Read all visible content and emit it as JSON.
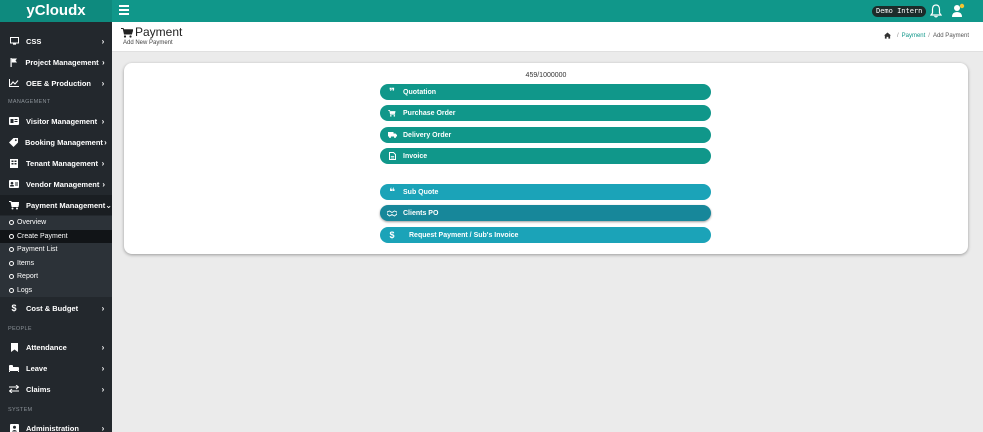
{
  "app": {
    "brand": "yCloudx",
    "demo_badge": "Demo Intern"
  },
  "sidebar": {
    "items_top": [
      {
        "label": "CSS",
        "icon": "monitor-icon"
      },
      {
        "label": "Project Management",
        "icon": "flag-icon"
      },
      {
        "label": "OEE & Production",
        "icon": "line-chart-icon"
      }
    ],
    "section_management": "MANAGEMENT",
    "items_management": [
      {
        "label": "Visitor Management",
        "icon": "id-card-icon"
      },
      {
        "label": "Booking Management",
        "icon": "tag-icon"
      },
      {
        "label": "Tenant Management",
        "icon": "building-icon"
      },
      {
        "label": "Vendor Management",
        "icon": "address-card-icon"
      },
      {
        "label": "Payment Management",
        "icon": "cart-icon"
      }
    ],
    "payment_sub": [
      {
        "label": "Overview"
      },
      {
        "label": "Create Payment"
      },
      {
        "label": "Payment List"
      },
      {
        "label": "Items"
      },
      {
        "label": "Report"
      },
      {
        "label": "Logs"
      }
    ],
    "cost_budget": {
      "label": "Cost & Budget",
      "icon": "dollar-icon"
    },
    "section_people": "PEOPLE",
    "items_people": [
      {
        "label": "Attendance",
        "icon": "bookmark-icon"
      },
      {
        "label": "Leave",
        "icon": "bed-icon"
      },
      {
        "label": "Claims",
        "icon": "exchange-icon"
      }
    ],
    "section_system": "SYSTEM",
    "administration": {
      "label": "Administration",
      "icon": "user-box-icon"
    }
  },
  "header": {
    "title": "Payment",
    "subtitle": "Add New Payment",
    "breadcrumb": {
      "link": "Payment",
      "current": "Add Payment"
    }
  },
  "main": {
    "counter": "459/1000000",
    "buttons_primary": [
      {
        "label": "Quotation",
        "icon": "quote-icon"
      },
      {
        "label": "Purchase Order",
        "icon": "cart-icon"
      },
      {
        "label": "Delivery Order",
        "icon": "truck-icon"
      },
      {
        "label": "Invoice",
        "icon": "file-icon"
      }
    ],
    "buttons_secondary": [
      {
        "label": "Sub Quote",
        "icon": "quote-icon"
      },
      {
        "label": "Clients PO",
        "icon": "handshake-icon"
      },
      {
        "label": "Request Payment / Sub's Invoice",
        "icon": "dollar-icon"
      }
    ]
  },
  "colors": {
    "accent": "#10978a",
    "secondary": "#1ba3b8",
    "sidebar": "#23282d"
  }
}
